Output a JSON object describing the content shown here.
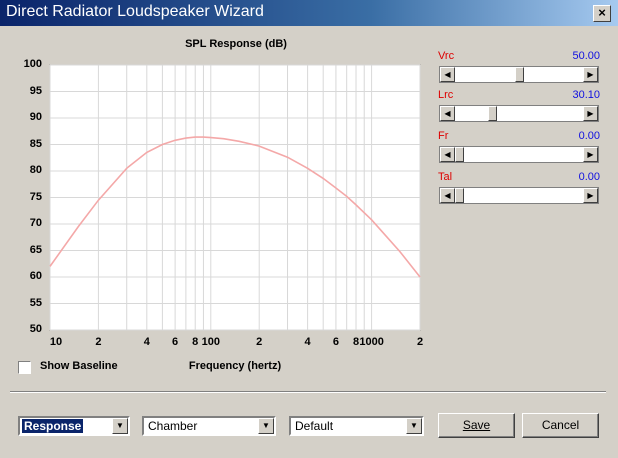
{
  "window": {
    "title": "Direct Radiator Loudspeaker Wizard",
    "close_label": "×"
  },
  "chart_data": {
    "type": "line",
    "title": "SPL Response (dB)",
    "xlabel": "Frequency (hertz)",
    "ylabel": "",
    "xscale": "log",
    "xlim": [
      10,
      2000
    ],
    "ylim": [
      50,
      100
    ],
    "grid": true,
    "yticks": [
      "100",
      "95",
      "90",
      "85",
      "80",
      "75",
      "70",
      "65",
      "60",
      "55",
      "50"
    ],
    "xticks": [
      "10",
      "2",
      "4",
      "6",
      "8",
      "100",
      "2",
      "4",
      "6",
      "8",
      "1000",
      "2"
    ],
    "series": [
      {
        "color": "#f4a8a8",
        "x": [
          10,
          15,
          20,
          30,
          40,
          50,
          60,
          70,
          80,
          90,
          100,
          120,
          150,
          200,
          300,
          400,
          500,
          600,
          700,
          800,
          1000,
          1500,
          2000
        ],
        "y": [
          62,
          69.5,
          74.5,
          80.5,
          83.5,
          85,
          85.8,
          86.2,
          86.4,
          86.4,
          86.3,
          86.1,
          85.6,
          84.7,
          82.6,
          80.5,
          78.6,
          76.8,
          75.2,
          73.6,
          70.8,
          64.8,
          60
        ]
      }
    ]
  },
  "controls": {
    "show_baseline_label": "Show Baseline",
    "sliders": [
      {
        "label": "Vrc",
        "value": "50.00",
        "level": 0.5
      },
      {
        "label": "Lrc",
        "value": "30.10",
        "level": 0.28
      },
      {
        "label": "Fr",
        "value": "0.00",
        "level": 0
      },
      {
        "label": "Tal",
        "value": "0.00",
        "level": 0
      }
    ]
  },
  "footer": {
    "combo_view": "Response",
    "combo_enclosure": "Chamber",
    "combo_preset": "Default",
    "save_label": "Save",
    "cancel_label": "Cancel"
  },
  "icons": {
    "left_arrow": "◀",
    "right_arrow": "▶",
    "down_arrow": "▼"
  }
}
